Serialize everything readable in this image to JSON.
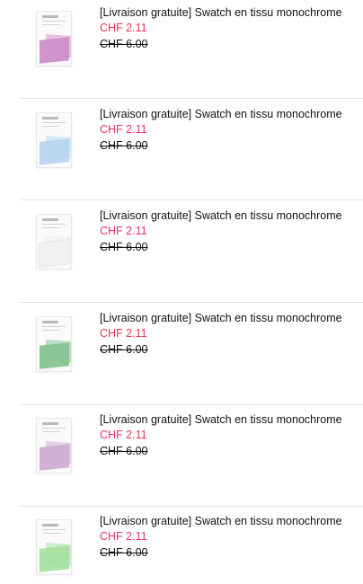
{
  "colors": {
    "sale_price": "#e8335a",
    "text": "#111111",
    "divider": "#e3e3e3"
  },
  "products": [
    {
      "title": "[Livraison gratuite] Swatch en tissu monochrome",
      "price": "CHF 2.11",
      "old_price": "CHF 6.00",
      "swatch_color": "#cf8fcb",
      "swatch_label": "swatch-pink"
    },
    {
      "title": "[Livraison gratuite] Swatch en tissu monochrome",
      "price": "CHF 2.11",
      "old_price": "CHF 6.00",
      "swatch_color": "#b9d6ef",
      "swatch_label": "swatch-light-blue"
    },
    {
      "title": "[Livraison gratuite] Swatch en tissu monochrome",
      "price": "CHF 2.11",
      "old_price": "CHF 6.00",
      "swatch_color": "#f1f1ef",
      "swatch_label": "swatch-white"
    },
    {
      "title": "[Livraison gratuite] Swatch en tissu monochrome",
      "price": "CHF 2.11",
      "old_price": "CHF 6.00",
      "swatch_color": "#86c493",
      "swatch_label": "swatch-green"
    },
    {
      "title": "[Livraison gratuite] Swatch en tissu monochrome",
      "price": "CHF 2.11",
      "old_price": "CHF 6.00",
      "swatch_color": "#cfaed3",
      "swatch_label": "swatch-lilac"
    },
    {
      "title": "[Livraison gratuite] Swatch en tissu monochrome",
      "price": "CHF 2.11",
      "old_price": "CHF 6.00",
      "swatch_color": "#a6e0a0",
      "swatch_label": "swatch-light-green"
    }
  ]
}
